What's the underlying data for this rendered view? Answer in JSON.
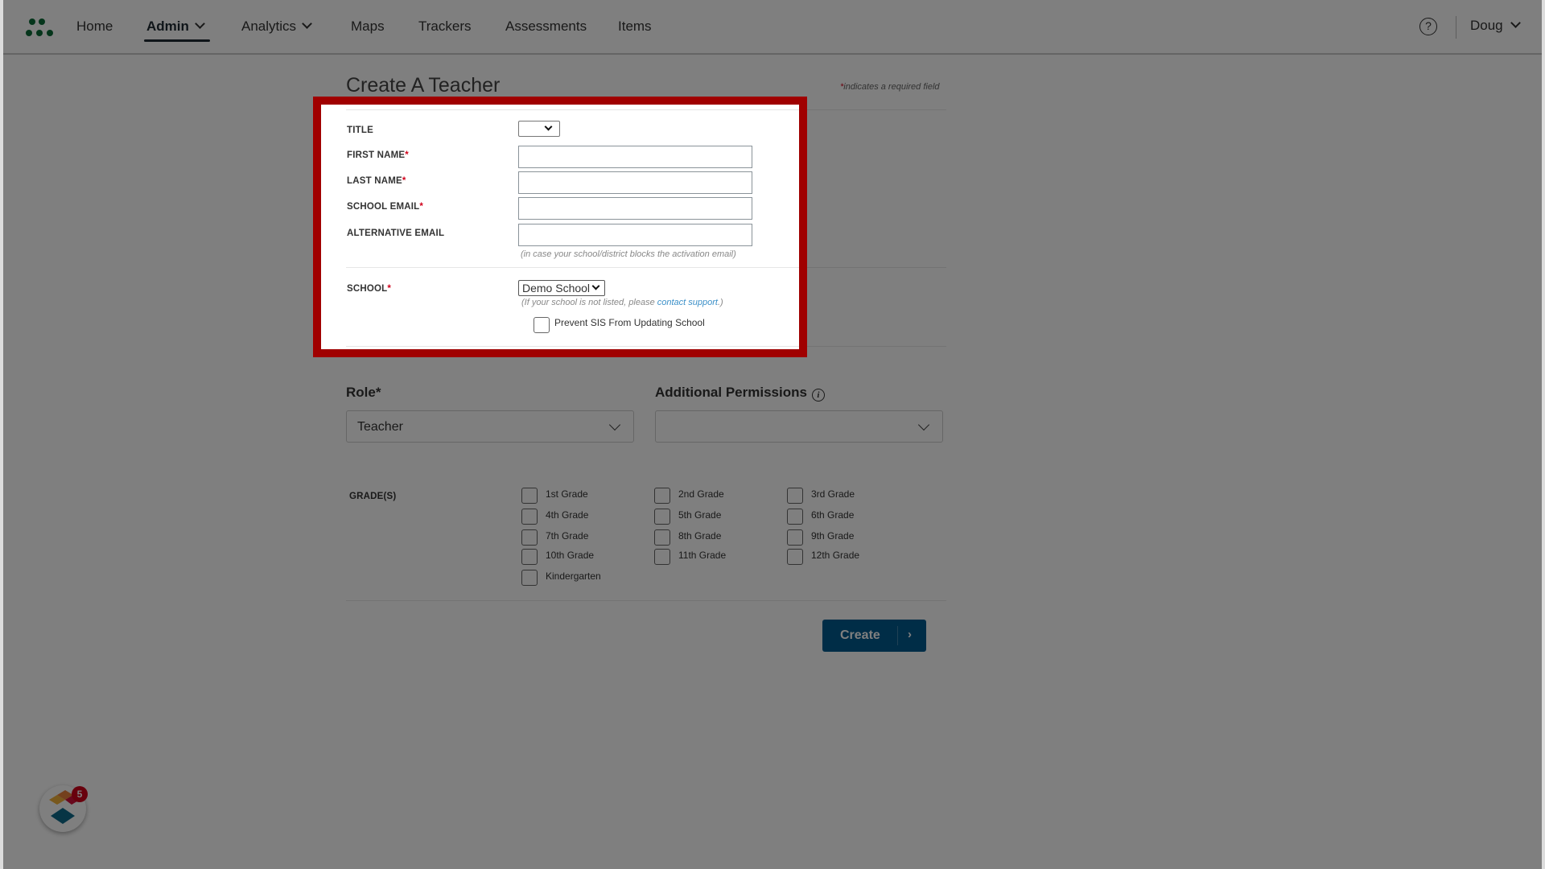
{
  "nav": {
    "items": [
      {
        "label": "Home",
        "active": false,
        "has_menu": false
      },
      {
        "label": "Admin",
        "active": true,
        "has_menu": true
      },
      {
        "label": "Analytics",
        "active": false,
        "has_menu": true
      },
      {
        "label": "Maps",
        "active": false,
        "has_menu": false
      },
      {
        "label": "Trackers",
        "active": false,
        "has_menu": false
      },
      {
        "label": "Assessments",
        "active": false,
        "has_menu": false
      },
      {
        "label": "Items",
        "active": false,
        "has_menu": false
      }
    ],
    "help_icon": "?",
    "user_name": "Doug"
  },
  "form": {
    "title": "Create A Teacher",
    "required_note_star": "*",
    "required_note": "indicates a required field",
    "fields": {
      "title": {
        "label": "TITLE",
        "value": ""
      },
      "first_name": {
        "label": "FIRST NAME",
        "required": "*",
        "value": ""
      },
      "last_name": {
        "label": "LAST NAME",
        "required": "*",
        "value": ""
      },
      "school_email": {
        "label": "SCHOOL EMAIL",
        "required": "*",
        "value": ""
      },
      "alternative_email": {
        "label": "ALTERNATIVE EMAIL",
        "value": "",
        "hint": "(in case your school/district blocks the activation email)"
      },
      "school": {
        "label": "SCHOOL",
        "required": "*",
        "value": "Demo School",
        "hint_prefix": "(If your school is not listed, please ",
        "hint_link": "contact support",
        "hint_suffix": ".)"
      },
      "prevent_sis": {
        "label": "Prevent SIS From Updating School",
        "checked": false
      }
    },
    "role": {
      "label": "Role*",
      "value": "Teacher"
    },
    "additional_permissions": {
      "label": "Additional Permissions",
      "info_icon": "i",
      "value": ""
    },
    "grades": {
      "label": "GRADE(S)",
      "options": [
        "1st Grade",
        "2nd Grade",
        "3rd Grade",
        "4th Grade",
        "5th Grade",
        "6th Grade",
        "7th Grade",
        "8th Grade",
        "9th Grade",
        "10th Grade",
        "11th Grade",
        "12th Grade",
        "Kindergarten"
      ]
    },
    "create_button": {
      "label": "Create",
      "arrow": "›"
    }
  },
  "widget": {
    "badge_count": "5"
  },
  "colors": {
    "highlight": "#a00000",
    "primary_button": "#005a8f",
    "required_star": "#d0021b",
    "link": "#3a8fc8",
    "logo_green": "#0a6b37"
  }
}
